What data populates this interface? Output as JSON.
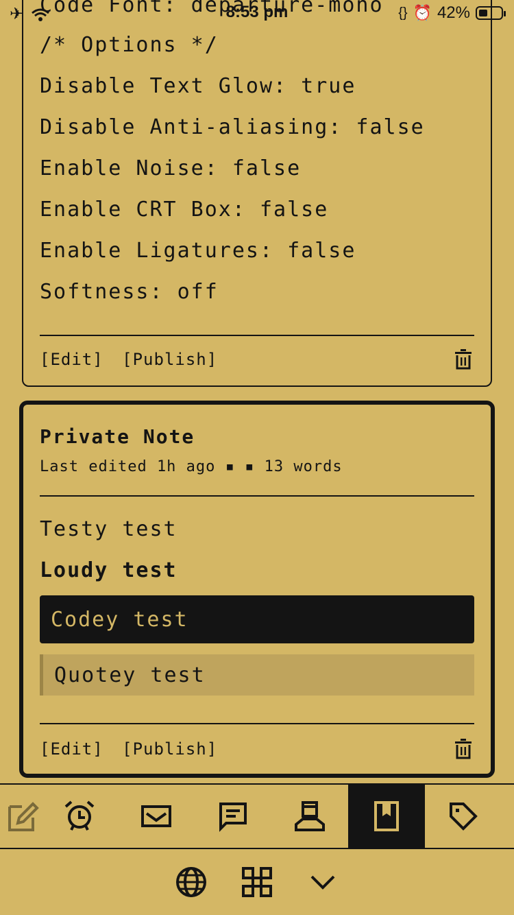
{
  "status_bar": {
    "time": "8:53 pm",
    "battery": "42%"
  },
  "card1": {
    "lines": [
      "Code Font: departure-mono",
      "/* Options */",
      "Disable Text Glow: true",
      "Disable Anti-aliasing: false",
      "Enable Noise: false",
      "Enable CRT Box: false",
      "Enable Ligatures: false",
      "Softness: off"
    ],
    "edit_label": "[Edit]",
    "publish_label": "[Publish]"
  },
  "card2": {
    "title": "Private Note",
    "meta": "Last edited 1h ago ▪ ▪ 13 words",
    "text": "Testy test",
    "heading": "Loudy test",
    "code": "Codey test",
    "quote": "Quotey test",
    "edit_label": "[Edit]",
    "publish_label": "[Publish]"
  },
  "tabs": [
    {
      "icon": "compose-icon"
    },
    {
      "icon": "alarm-clock-icon"
    },
    {
      "icon": "mail-icon"
    },
    {
      "icon": "chat-icon"
    },
    {
      "icon": "profile-icon"
    },
    {
      "icon": "bookmark-icon",
      "active": true
    },
    {
      "icon": "tag-icon"
    }
  ],
  "bottom_icons": [
    "globe-icon",
    "command-icon",
    "chevron-down-icon"
  ],
  "colors": {
    "background": "#d4b765",
    "ink": "#141414",
    "quote_bg": "#bfa45d"
  }
}
